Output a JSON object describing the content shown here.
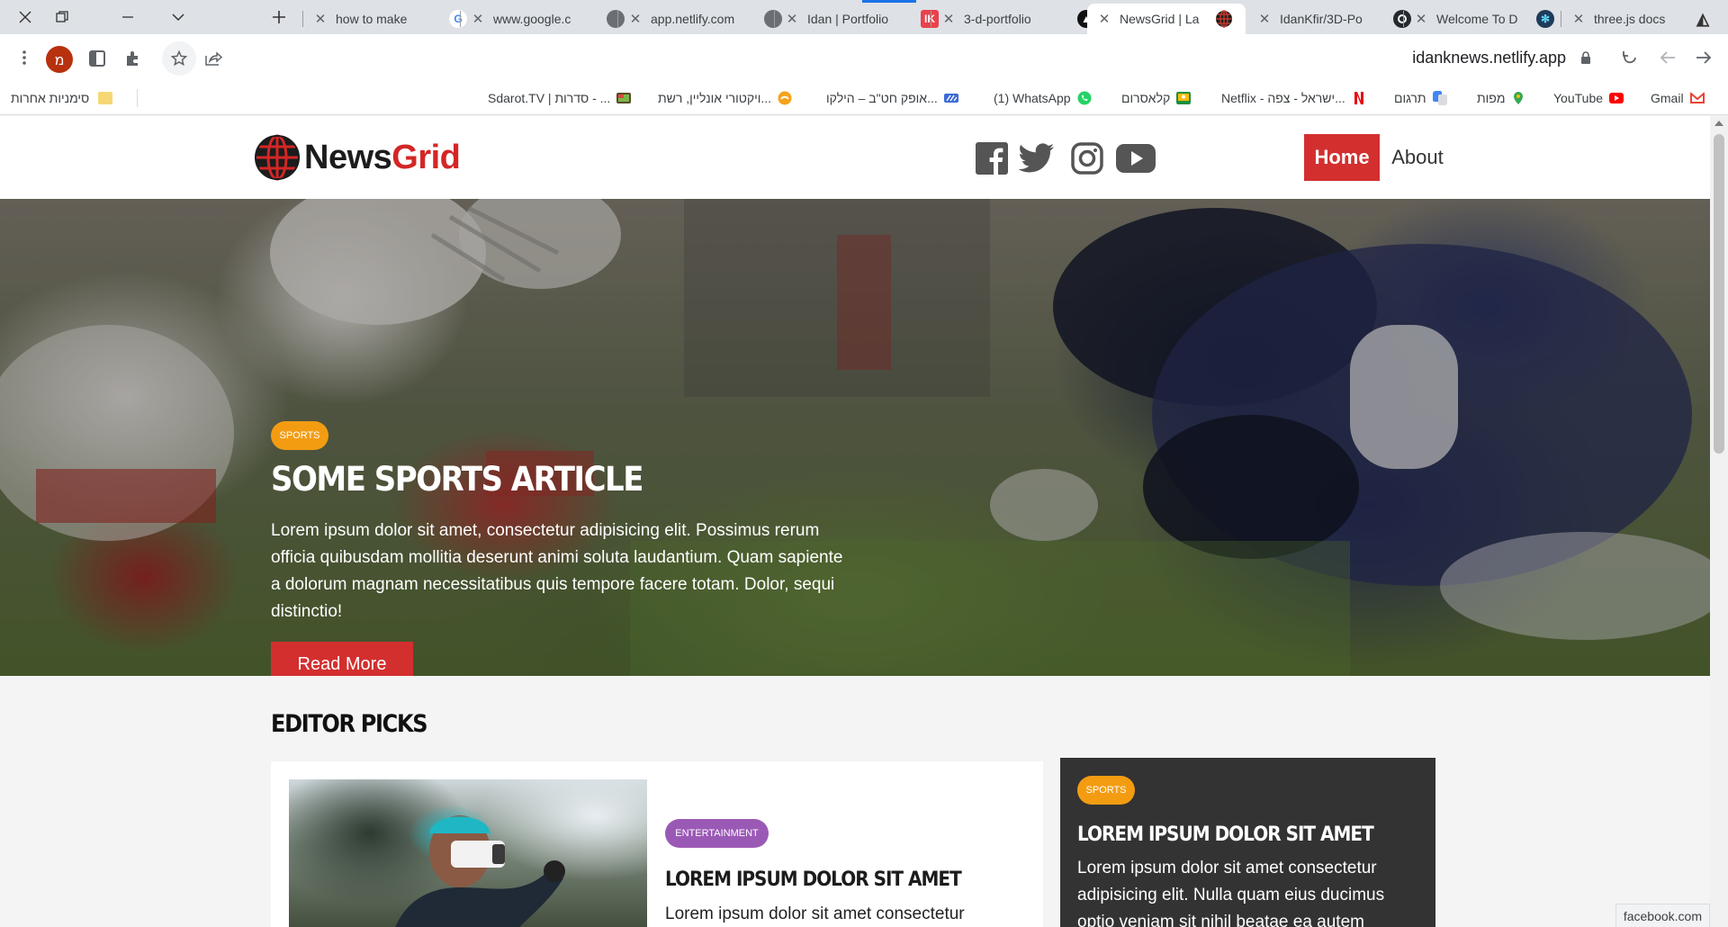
{
  "browser": {
    "tabs": [
      {
        "title": "how to make",
        "fav_color": "#ffffff",
        "fav_glyph": "G",
        "fav_text_color": "#4285f4"
      },
      {
        "title": "www.google.c",
        "fav_color": "#6b6f73",
        "fav_glyph": "",
        "fav_text_color": "#ffffff"
      },
      {
        "title": "app.netlify.com",
        "fav_color": "#6b6f73",
        "fav_glyph": "",
        "fav_text_color": "#ffffff"
      },
      {
        "title": "Idan | Portfolio",
        "fav_color": "#e8424c",
        "fav_glyph": "IK",
        "fav_text_color": "#ffffff"
      },
      {
        "title": "3-d-portfolio",
        "fav_color": "#111111",
        "fav_glyph": "▲",
        "fav_text_color": "#ffffff"
      },
      {
        "title": "NewsGrid | La",
        "fav_color": "#c0392b",
        "fav_glyph": "",
        "fav_text_color": "#ffffff"
      },
      {
        "title": "IdanKfir/3D-Po",
        "fav_color": "#24292e",
        "fav_glyph": "",
        "fav_text_color": "#ffffff"
      },
      {
        "title": "Welcome To D",
        "fav_color": "#1f3b5a",
        "fav_glyph": "✻",
        "fav_text_color": "#61dafb"
      },
      {
        "title": "three.js docs",
        "fav_color": "#ffffff",
        "fav_glyph": "◭",
        "fav_text_color": "#333333"
      }
    ],
    "active_tab_index": 5,
    "url": "idanknews.netlify.app",
    "profile_initial": "מ",
    "bookmarks": [
      {
        "label": "Gmail",
        "color": "#ea4335"
      },
      {
        "label": "YouTube",
        "color": "#ff0000"
      },
      {
        "label": "מפות",
        "color": "#34a853"
      },
      {
        "label": "תרגום",
        "color": "#4285f4"
      },
      {
        "label": "Netflix - ישראל - צפה...",
        "color": "#e50914"
      },
      {
        "label": "קלאסרום",
        "color": "#1e8e3e"
      },
      {
        "label": "(1) WhatsApp",
        "color": "#25d366"
      },
      {
        "label": "אופק חט\"ב – הילקו...",
        "color": "#3b6bd6"
      },
      {
        "label": "ויקטורי אונליין, רשת...",
        "color": "#f7a21b"
      },
      {
        "label": "Sdarot.TV | סדרות - ...",
        "color": "#7a5c2e"
      }
    ],
    "other_bookmarks": "סימניות אחרות",
    "status_tooltip": "facebook.com"
  },
  "site": {
    "logo_part1": "News",
    "logo_part2": "Grid",
    "nav": {
      "home": "Home",
      "about": "About"
    },
    "hero": {
      "badge": "Sports",
      "title": "SOME SPORTS ARTICLE",
      "text": "Lorem ipsum dolor sit amet, consectetur adipisicing elit. Possimus rerum officia quibusdam mollitia deserunt animi soluta laudantium. Quam sapiente a dolorum magnam necessitatibus quis tempore facere totam. Dolor, sequi distinctio!",
      "button": "Read More"
    },
    "editor_picks": {
      "title": "EDITOR PICKS",
      "card1": {
        "badge": "Entertainment",
        "title": "Lorem ipsum dolor sit amet",
        "text": "Lorem ipsum dolor sit amet consectetur adipisicing elit. Nulla quam eius ducimus optio"
      },
      "card2": {
        "badge": "Sports",
        "title": "Lorem ipsum dolor sit amet",
        "text": "Lorem ipsum dolor sit amet consectetur adipisicing elit. Nulla quam eius ducimus optio veniam sit nihil beatae ea autem"
      }
    }
  }
}
